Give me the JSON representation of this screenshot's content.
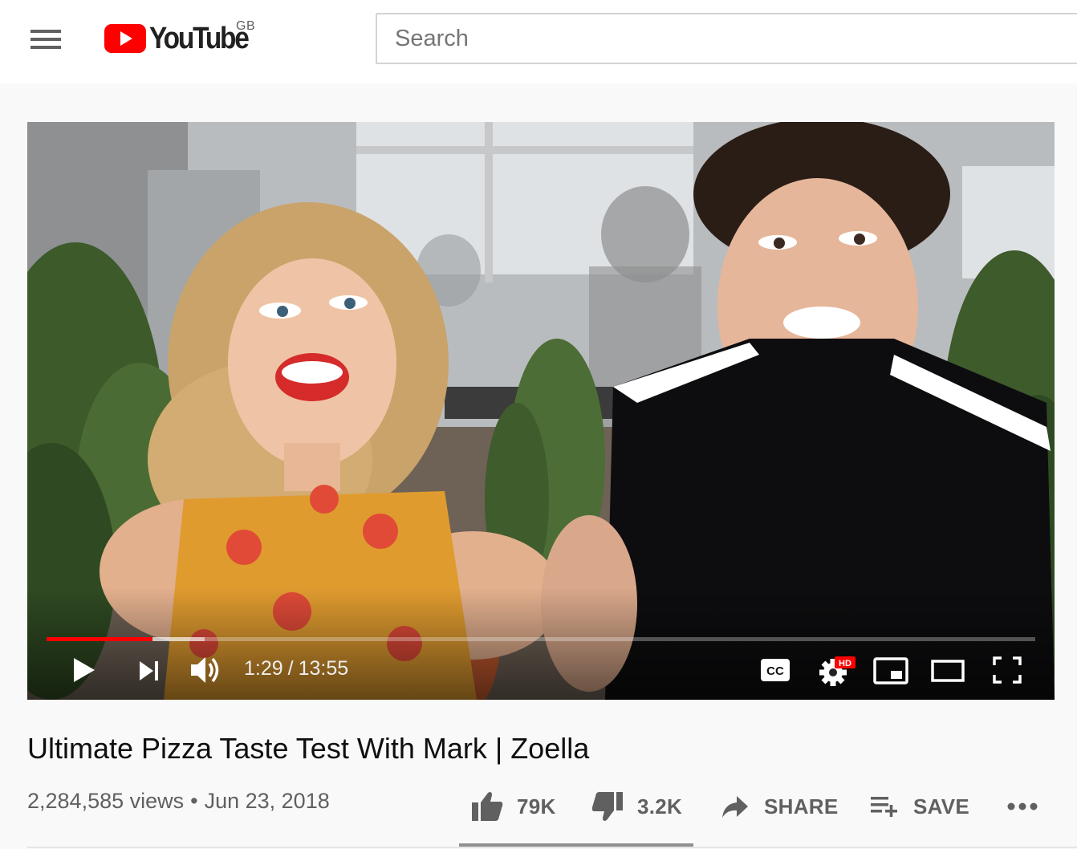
{
  "masthead": {
    "logo_text": "YouTube",
    "country_code": "GB",
    "search_placeholder": "Search"
  },
  "player": {
    "current_time": "1:29",
    "time_separator": "/",
    "duration": "13:55",
    "progress_played_fraction": 0.107,
    "progress_loaded_fraction": 0.16,
    "hd_badge": "HD",
    "cc_label": "CC",
    "accent_color": "#ff0000"
  },
  "video": {
    "title": "Ultimate Pizza Taste Test With Mark | Zoella",
    "views": "2,284,585 views",
    "info_separator": "•",
    "date": "Jun 23, 2018"
  },
  "actions": {
    "like_count": "79K",
    "dislike_count": "3.2K",
    "share_label": "SHARE",
    "save_label": "SAVE"
  }
}
